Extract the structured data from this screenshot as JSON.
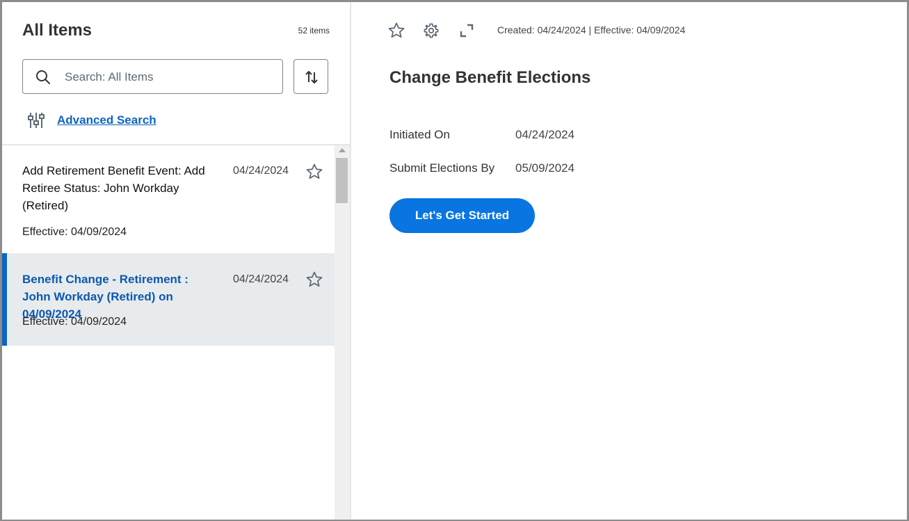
{
  "left_pane": {
    "title": "All Items",
    "count": "52 items",
    "search": {
      "placeholder": "Search: All Items"
    },
    "advanced_search_label": "Advanced Search",
    "items": [
      {
        "title": "Add Retirement Benefit Event: Add Retiree Status: John Workday (Retired)",
        "date": "04/24/2024",
        "effective": "Effective: 04/09/2024",
        "selected": false
      },
      {
        "title": "Benefit Change - Retirement : John Workday (Retired) on 04/09/2024",
        "date": "04/24/2024",
        "effective": "Effective: 04/09/2024",
        "selected": true
      }
    ]
  },
  "detail": {
    "meta": "Created: 04/24/2024 | Effective: 04/09/2024",
    "title": "Change Benefit Elections",
    "fields": [
      {
        "label": "Initiated On",
        "value": "04/24/2024"
      },
      {
        "label": "Submit Elections By",
        "value": "05/09/2024"
      }
    ],
    "cta_label": "Let's Get Started"
  },
  "icons": {
    "star": "star-outline-icon",
    "settings": "gear-icon",
    "expand": "expand-icon",
    "search": "search-icon",
    "sort": "sort-arrows-icon",
    "filters": "sliders-icon"
  },
  "colors": {
    "accent": "#0875e1",
    "link": "#0b65c2",
    "selected_row_bg": "#e8ebed",
    "selected_bar": "#0b65c2"
  }
}
